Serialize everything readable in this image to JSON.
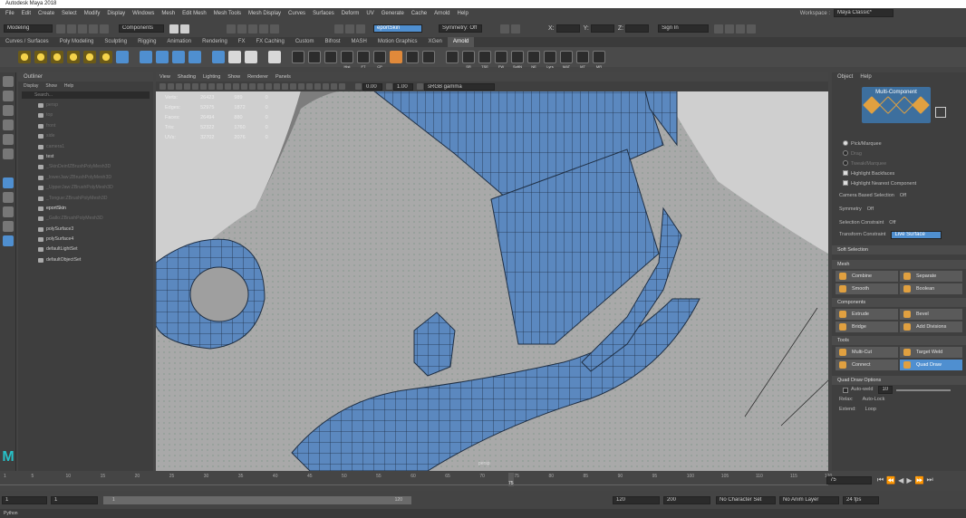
{
  "title": "Autodesk Maya 2018",
  "menu": [
    "File",
    "Edit",
    "Create",
    "Select",
    "Modify",
    "Display",
    "Windows",
    "Mesh",
    "Edit Mesh",
    "Mesh Tools",
    "Mesh Display",
    "Curves",
    "Surfaces",
    "Deform",
    "UV",
    "Generate",
    "Cache",
    "Arnold",
    "Help"
  ],
  "workspace": {
    "label": "Workspace :",
    "value": "Maya Classic*"
  },
  "status": {
    "mode": "Modeling",
    "components": "Components",
    "live": "eportSkin",
    "symmetry": "Symmetry: Off",
    "sign_in": "Sign In",
    "x": "X:",
    "y": "Y:",
    "z": "Z:"
  },
  "shelf_tabs": [
    "Curves / Surfaces",
    "Poly Modeling",
    "Sculpting",
    "Rigging",
    "Animation",
    "Rendering",
    "FX",
    "FX Caching",
    "Custom",
    "Bifrost",
    "MASH",
    "Motion Graphics",
    "XGen",
    "Arnold"
  ],
  "shelf_active": "Arnold",
  "shelf_labels": [
    "Hist",
    "FT",
    "CP",
    "SR",
    "TSE",
    "FW",
    "SoftN",
    "NE",
    "Lyrs",
    "MAT",
    "MT",
    "MR"
  ],
  "outliner": {
    "title": "Outliner",
    "menu": [
      "Display",
      "Show",
      "Help"
    ],
    "search": "Search...",
    "items": [
      {
        "label": "persp",
        "state": "dim"
      },
      {
        "label": "top",
        "state": "dim"
      },
      {
        "label": "front",
        "state": "dim"
      },
      {
        "label": "side",
        "state": "dim"
      },
      {
        "label": "camera1",
        "state": "dim"
      },
      {
        "label": "test",
        "state": "normal"
      },
      {
        "label": "_SkinDeinfZBrushPolyMesh3D",
        "state": "dim"
      },
      {
        "label": "_lowerJaw:ZBrushPolyMesh3D",
        "state": "dim"
      },
      {
        "label": "_UpperJaw:ZBrushPolyMesh3D",
        "state": "dim"
      },
      {
        "label": "_Tongue:ZBrushPolyMesh3D",
        "state": "dim"
      },
      {
        "label": "eportSkin",
        "state": "bright"
      },
      {
        "label": "_Gallo:ZBrushPolyMesh3D",
        "state": "dim"
      },
      {
        "label": "polySurface3",
        "state": "normal"
      },
      {
        "label": "polySurface4",
        "state": "normal"
      },
      {
        "label": "defaultLightSet",
        "state": "normal"
      },
      {
        "label": "defaultObjectSet",
        "state": "normal"
      }
    ]
  },
  "viewport": {
    "menu": [
      "View",
      "Shading",
      "Lighting",
      "Show",
      "Renderer",
      "Panels"
    ],
    "exposure": "0.00",
    "gamma": "1.00",
    "colorspace": "sRGB gamma",
    "hud": [
      {
        "label": "Verts:",
        "a": "26423",
        "b": "989",
        "c": "0"
      },
      {
        "label": "Edges:",
        "a": "52975",
        "b": "1872",
        "c": "0"
      },
      {
        "label": "Faces:",
        "a": "26494",
        "b": "880",
        "c": "0"
      },
      {
        "label": "Tris:",
        "a": "52322",
        "b": "1760",
        "c": "0"
      },
      {
        "label": "UVs:",
        "a": "32702",
        "b": "2076",
        "c": "0"
      }
    ],
    "camera": "persp"
  },
  "attr": {
    "menu": [
      "Object",
      "Help"
    ],
    "mode": "Multi-Component",
    "options": [
      {
        "label": "Pick/Marquee",
        "type": "radio",
        "state": "on"
      },
      {
        "label": "Drag",
        "type": "radio",
        "state": "dim"
      },
      {
        "label": "Tweak/Marquee",
        "type": "radio",
        "state": "dim"
      },
      {
        "label": "Highlight Backfaces",
        "type": "check",
        "state": "on"
      },
      {
        "label": "Highlight Nearest Component",
        "type": "check",
        "state": "on"
      }
    ],
    "camera_based": "Camera Based Selection",
    "camera_based_val": "Off",
    "symmetry": "Symmetry",
    "symmetry_val": "Off",
    "sel_constraint": "Selection Constraint",
    "sel_constraint_val": "Off",
    "transform_constraint": "Transform Constraint",
    "transform_constraint_val": "Live Surface",
    "soft_selection": "Soft Selection",
    "mesh_title": "Mesh",
    "mesh": [
      "Combine",
      "Separate",
      "Smooth",
      "Boolean"
    ],
    "components_title": "Components",
    "components": [
      "Extrude",
      "Bevel",
      "Bridge",
      "Add Divisions"
    ],
    "tools_title": "Tools",
    "tools": [
      "Multi-Cut",
      "Target Weld",
      "Connect",
      "Quad Draw"
    ],
    "tools_active": "Quad Draw",
    "quad_title": "Quad Draw Options",
    "auto_weld": "Auto-weld",
    "auto_weld_val": "10",
    "relax": "Relax:",
    "relax_val": "Auto-Lock",
    "extend": "Extend:",
    "extend_val": "Loop"
  },
  "time": {
    "ticks": [
      "1",
      "5",
      "10",
      "15",
      "20",
      "25",
      "30",
      "35",
      "40",
      "45",
      "50",
      "55",
      "60",
      "65",
      "70",
      "75",
      "80",
      "85",
      "90",
      "95",
      "100",
      "105",
      "110",
      "115",
      "120"
    ],
    "current": "75",
    "range_start": "1",
    "range_start2": "1",
    "range_inner_start": "1",
    "range_inner_end": "120",
    "range_end": "120",
    "range_end2": "200",
    "char_set": "No Character Set",
    "anim_layer": "No Anim Layer",
    "fps": "24 fps"
  },
  "cmd": "Python"
}
